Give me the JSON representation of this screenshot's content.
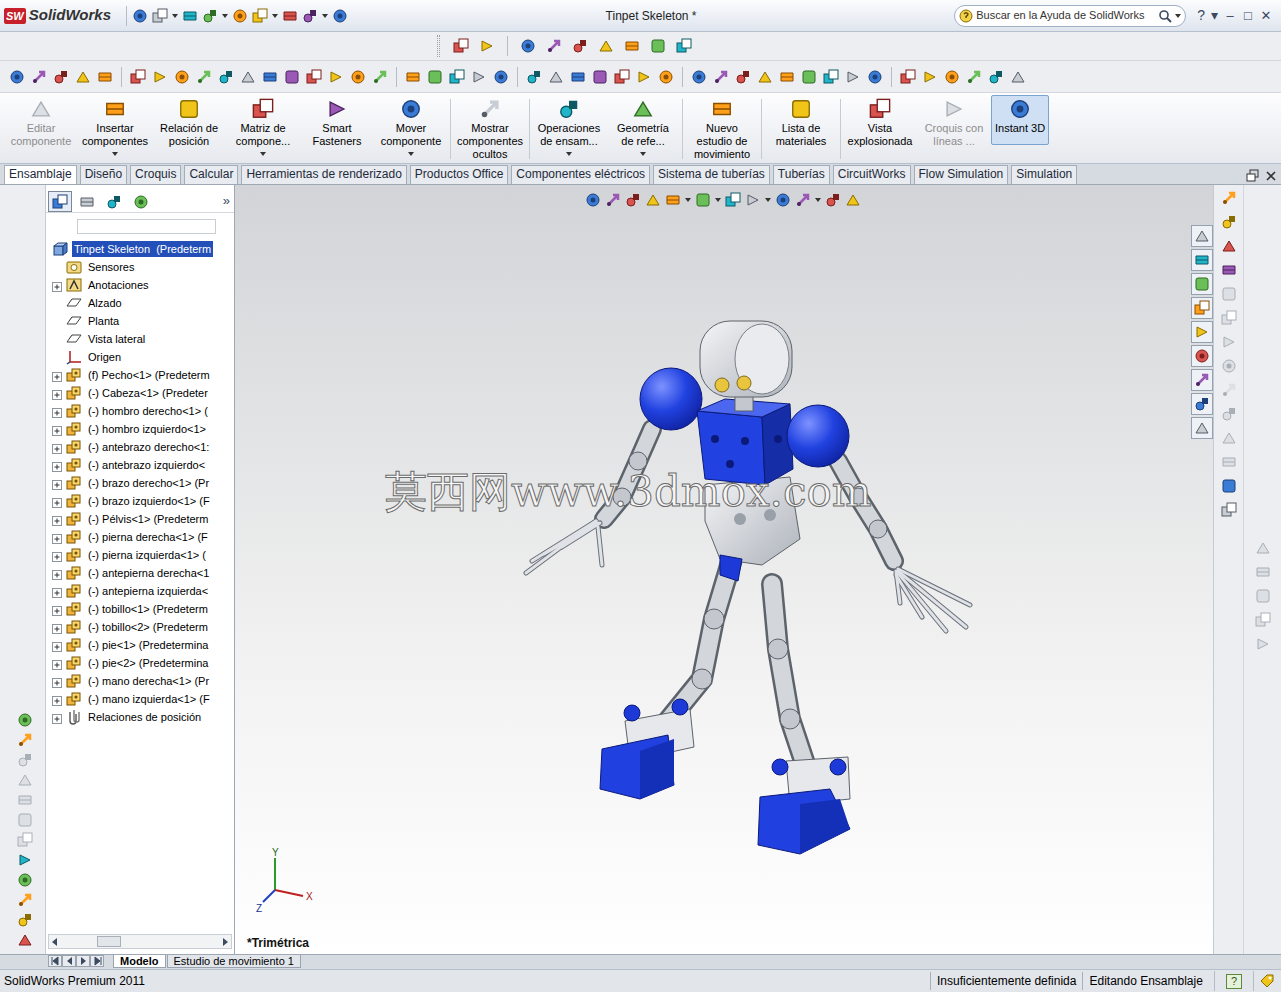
{
  "window": {
    "logo_mark": "SW",
    "app_name": "SolidWorks",
    "title": "Tinpet Skeleton *",
    "help": "?",
    "help_menu": "▾",
    "controls": [
      "–",
      "□",
      "✕"
    ]
  },
  "search": {
    "placeholder": "Buscar en la Ayuda de SolidWorks"
  },
  "command_buttons": [
    {
      "label": "Editar componente",
      "disabled": true,
      "selected": false,
      "has_menu": false
    },
    {
      "label": "Insertar componentes",
      "disabled": false,
      "selected": false,
      "has_menu": true
    },
    {
      "label": "Relación de posición",
      "disabled": false,
      "selected": false,
      "has_menu": false
    },
    {
      "label": "Matriz de compone...",
      "disabled": false,
      "selected": false,
      "has_menu": true
    },
    {
      "label": "Smart Fasteners",
      "disabled": false,
      "selected": false,
      "has_menu": false
    },
    {
      "label": "Mover componente",
      "disabled": false,
      "selected": false,
      "has_menu": true
    },
    {
      "label": "Mostrar componentes ocultos",
      "disabled": false,
      "selected": false,
      "has_menu": false
    },
    {
      "label": "Operaciones de ensam...",
      "disabled": false,
      "selected": false,
      "has_menu": true
    },
    {
      "label": "Geometría de refe...",
      "disabled": false,
      "selected": false,
      "has_menu": true
    },
    {
      "label": "Nuevo estudio de movimiento",
      "disabled": false,
      "selected": false,
      "has_menu": false
    },
    {
      "label": "Lista de materiales",
      "disabled": false,
      "selected": false,
      "has_menu": false
    },
    {
      "label": "Vista explosionada",
      "disabled": false,
      "selected": false,
      "has_menu": false
    },
    {
      "label": "Croquis con líneas ...",
      "disabled": true,
      "selected": false,
      "has_menu": false
    },
    {
      "label": "Instant 3D",
      "disabled": false,
      "selected": true,
      "has_menu": false
    }
  ],
  "tabs": [
    {
      "label": "Ensamblaje",
      "selected": true
    },
    {
      "label": "Diseño",
      "selected": false
    },
    {
      "label": "Croquis",
      "selected": false
    },
    {
      "label": "Calcular",
      "selected": false
    },
    {
      "label": "Herramientas de renderizado",
      "selected": false
    },
    {
      "label": "Productos Office",
      "selected": false
    },
    {
      "label": "Componentes eléctricos",
      "selected": false
    },
    {
      "label": "Sistema de tuberías",
      "selected": false
    },
    {
      "label": "Tuberías",
      "selected": false
    },
    {
      "label": "CircuitWorks",
      "selected": false
    },
    {
      "label": "Flow Simulation",
      "selected": false
    },
    {
      "label": "Simulation",
      "selected": false
    }
  ],
  "tree_tabs": [
    {
      "selected": true
    },
    {
      "selected": false
    },
    {
      "selected": false
    },
    {
      "selected": false
    }
  ],
  "tree_more": "»",
  "tree": [
    {
      "label": "Tinpet Skeleton  (Predeterm",
      "kind": "root",
      "expandable": false,
      "selected": true
    },
    {
      "label": "Sensores",
      "kind": "sensor",
      "expandable": false,
      "selected": false
    },
    {
      "label": "Anotaciones",
      "kind": "annotation",
      "expandable": true,
      "selected": false
    },
    {
      "label": "Alzado",
      "kind": "plane",
      "expandable": false,
      "selected": false
    },
    {
      "label": "Planta",
      "kind": "plane",
      "expandable": false,
      "selected": false
    },
    {
      "label": "Vista lateral",
      "kind": "plane",
      "expandable": false,
      "selected": false
    },
    {
      "label": "Origen",
      "kind": "origin",
      "expandable": false,
      "selected": false
    },
    {
      "label": "(f) Pecho<1> (Predeterm",
      "kind": "component",
      "expandable": true,
      "selected": false
    },
    {
      "label": "(-) Cabeza<1> (Predeter",
      "kind": "component",
      "expandable": true,
      "selected": false
    },
    {
      "label": "(-) hombro derecho<1> (",
      "kind": "component",
      "expandable": true,
      "selected": false
    },
    {
      "label": "(-) hombro izquierdo<1>",
      "kind": "component",
      "expandable": true,
      "selected": false
    },
    {
      "label": "(-) antebrazo derecho<1:",
      "kind": "component",
      "expandable": true,
      "selected": false
    },
    {
      "label": "(-) antebrazo izquierdo<",
      "kind": "component",
      "expandable": true,
      "selected": false
    },
    {
      "label": "(-) brazo derecho<1> (Pr",
      "kind": "component",
      "expandable": true,
      "selected": false
    },
    {
      "label": "(-) brazo izquierdo<1> (F",
      "kind": "component",
      "expandable": true,
      "selected": false
    },
    {
      "label": "(-) Pélvis<1> (Predeterm",
      "kind": "component",
      "expandable": true,
      "selected": false
    },
    {
      "label": "(-) pierna derecha<1> (F",
      "kind": "component",
      "expandable": true,
      "selected": false
    },
    {
      "label": "(-) pierna izquierda<1> (",
      "kind": "component",
      "expandable": true,
      "selected": false
    },
    {
      "label": "(-) antepierna derecha<1",
      "kind": "component",
      "expandable": true,
      "selected": false
    },
    {
      "label": "(-) antepierna izquierda<",
      "kind": "component",
      "expandable": true,
      "selected": false
    },
    {
      "label": "(-) tobillo<1> (Predeterm",
      "kind": "component",
      "expandable": true,
      "selected": false
    },
    {
      "label": "(-) tobillo<2> (Predeterm",
      "kind": "component",
      "expandable": true,
      "selected": false
    },
    {
      "label": "(-) pie<1> (Predetermina",
      "kind": "component",
      "expandable": true,
      "selected": false
    },
    {
      "label": "(-) pie<2> (Predetermina",
      "kind": "component",
      "expandable": true,
      "selected": false
    },
    {
      "label": "(-) mano derecha<1> (Pr",
      "kind": "component",
      "expandable": true,
      "selected": false
    },
    {
      "label": "(-) mano izquierda<1> (F",
      "kind": "component",
      "expandable": true,
      "selected": false
    },
    {
      "label": "Relaciones de posición",
      "kind": "mates",
      "expandable": true,
      "selected": false
    }
  ],
  "viewport": {
    "watermark": "莫西网www.3dmox.com",
    "view_label": "*Trimétrica",
    "axes": {
      "y": "Y",
      "x": "X",
      "z": "Z"
    }
  },
  "bottom_tabs": [
    {
      "label": "Modelo",
      "selected": true
    },
    {
      "label": "Estudio de movimiento 1",
      "selected": false
    }
  ],
  "status_bar": {
    "product": "SolidWorks Premium 2011",
    "fields": [
      "Insuficientemente definida",
      "Editando Ensamblaje"
    ],
    "help": "?"
  }
}
